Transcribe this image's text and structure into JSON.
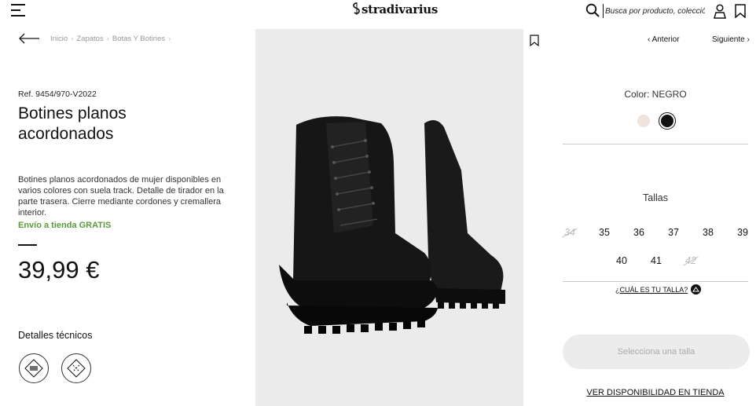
{
  "header": {
    "logo": "stradivarius",
    "search_placeholder": "Busca por producto, colección..."
  },
  "breadcrumb": [
    "Inicio",
    "Zapatos",
    "Botas Y Botines"
  ],
  "product": {
    "ref": "Ref. 9454/970-V2022",
    "title": "Botines planos acordonados",
    "description": "Botines planos acordonados de mujer disponibles en varios colores con suela track. Detalle de tirador en la parte trasera. Cierre mediante cordones y cremallera interior.",
    "shipping": "Envío a tienda GRATIS",
    "price": "39,99 €",
    "tech_details_title": "Detalles técnicos"
  },
  "navigation": {
    "prev": "Anterior",
    "next": "Siguiente"
  },
  "color": {
    "label": "Color: NEGRO",
    "swatches": [
      {
        "name": "beige",
        "hex": "#efe3dc",
        "selected": false
      },
      {
        "name": "negro",
        "hex": "#111111",
        "selected": true
      }
    ]
  },
  "sizes": {
    "label": "Tallas",
    "row1": [
      {
        "value": "34",
        "available": false
      },
      {
        "value": "35",
        "available": true
      },
      {
        "value": "36",
        "available": true
      },
      {
        "value": "37",
        "available": true
      },
      {
        "value": "38",
        "available": true
      },
      {
        "value": "39",
        "available": true
      }
    ],
    "row2": [
      {
        "value": "40",
        "available": true
      },
      {
        "value": "41",
        "available": true
      },
      {
        "value": "42",
        "available": false
      }
    ],
    "guide": "¿CUÁL ES TU TALLA?"
  },
  "actions": {
    "select_size": "Selecciona una talla",
    "store_availability": "VER DISPONIBILIDAD EN TIENDA"
  }
}
